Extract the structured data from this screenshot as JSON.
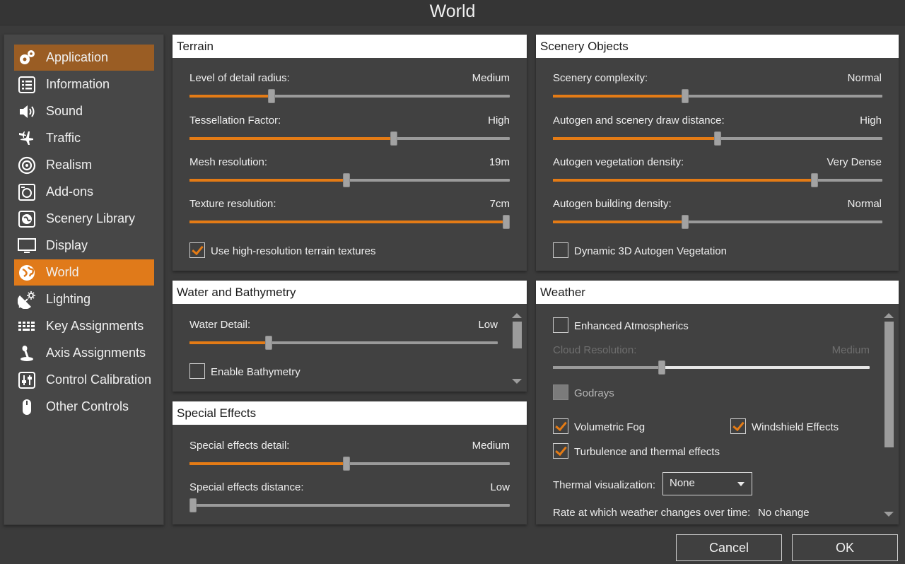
{
  "window": {
    "title": "World"
  },
  "sidebar": {
    "items": [
      {
        "label": "Application",
        "icon": "gears-icon",
        "state": "hover"
      },
      {
        "label": "Information",
        "icon": "list-icon",
        "state": ""
      },
      {
        "label": "Sound",
        "icon": "speaker-icon",
        "state": ""
      },
      {
        "label": "Traffic",
        "icon": "airplanes-icon",
        "state": ""
      },
      {
        "label": "Realism",
        "icon": "realism-icon",
        "state": ""
      },
      {
        "label": "Add-ons",
        "icon": "addons-icon",
        "state": ""
      },
      {
        "label": "Scenery Library",
        "icon": "scenery-library-icon",
        "state": ""
      },
      {
        "label": "Display",
        "icon": "monitor-icon",
        "state": ""
      },
      {
        "label": "World",
        "icon": "globe-icon",
        "state": "selected"
      },
      {
        "label": "Lighting",
        "icon": "lighting-icon",
        "state": ""
      },
      {
        "label": "Key Assignments",
        "icon": "keyboard-icon",
        "state": ""
      },
      {
        "label": "Axis Assignments",
        "icon": "joystick-icon",
        "state": ""
      },
      {
        "label": "Control Calibration",
        "icon": "sliders-icon",
        "state": ""
      },
      {
        "label": "Other Controls",
        "icon": "mouse-icon",
        "state": ""
      }
    ]
  },
  "terrain": {
    "title": "Terrain",
    "sliders": [
      {
        "label": "Level of detail radius:",
        "value": "Medium",
        "level": 0.25
      },
      {
        "label": "Tessellation Factor:",
        "value": "High",
        "level": 0.64
      },
      {
        "label": "Mesh resolution:",
        "value": "19m",
        "level": 0.49
      },
      {
        "label": "Texture resolution:",
        "value": "7cm",
        "level": 1.0
      }
    ],
    "checkbox": {
      "label": "Use high-resolution terrain textures",
      "checked": true
    }
  },
  "scenery": {
    "title": "Scenery Objects",
    "sliders": [
      {
        "label": "Scenery complexity:",
        "value": "Normal",
        "level": 0.4
      },
      {
        "label": "Autogen and scenery draw distance:",
        "value": "High",
        "level": 0.5
      },
      {
        "label": "Autogen vegetation density:",
        "value": "Very Dense",
        "level": 0.8
      },
      {
        "label": "Autogen building density:",
        "value": "Normal",
        "level": 0.4
      }
    ],
    "checkbox": {
      "label": "Dynamic 3D Autogen Vegetation",
      "checked": false
    }
  },
  "water": {
    "title": "Water and Bathymetry",
    "slider": {
      "label": "Water Detail:",
      "value": "Low",
      "level": 0.25
    },
    "checkbox": {
      "label": "Enable Bathymetry",
      "checked": false
    }
  },
  "effects": {
    "title": "Special Effects",
    "sliders": [
      {
        "label": "Special effects detail:",
        "value": "Medium",
        "level": 0.49
      },
      {
        "label": "Special effects distance:",
        "value": "Low",
        "level": 0.0
      }
    ]
  },
  "weather": {
    "title": "Weather",
    "enhanced_atmospherics": "Enhanced Atmospherics",
    "cloud_resolution": {
      "label": "Cloud Resolution:",
      "value": "Medium",
      "level": 0.34
    },
    "godrays": "Godrays",
    "volumetric_fog": "Volumetric Fog",
    "windshield_effects": "Windshield Effects",
    "turbulence": "Turbulence and thermal effects",
    "thermal_label": "Thermal visualization:",
    "thermal_value": "None",
    "rate_label": "Rate at which weather changes over time:",
    "rate_value": "No change"
  },
  "buttons": {
    "cancel": "Cancel",
    "ok": "OK"
  },
  "colors": {
    "accent": "#e47b15",
    "selected": "#e07a1a",
    "hover": "#9a5d24"
  }
}
